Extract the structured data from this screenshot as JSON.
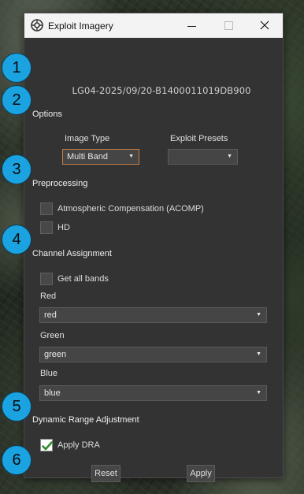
{
  "window": {
    "title": "Exploit Imagery",
    "app_icon": "gear-aperture-icon"
  },
  "image_id": "LG04-2025/09/20-B1400011019DB900",
  "sections": {
    "options": "Options",
    "preprocessing": "Preprocessing",
    "channel_assignment": "Channel Assignment",
    "dynamic_range": "Dynamic Range Adjustment"
  },
  "options": {
    "image_type_label": "Image Type",
    "image_type_value": "Multi Band",
    "exploit_presets_label": "Exploit Presets",
    "exploit_presets_value": ""
  },
  "preprocessing": {
    "acomp_label": "Atmospheric Compensation (ACOMP)",
    "acomp_checked": false,
    "hd_label": "HD",
    "hd_checked": false
  },
  "channels": {
    "get_all_bands_label": "Get all bands",
    "get_all_bands_checked": false,
    "red_label": "Red",
    "red_value": "red",
    "green_label": "Green",
    "green_value": "green",
    "blue_label": "Blue",
    "blue_value": "blue"
  },
  "dra": {
    "apply_dra_label": "Apply DRA",
    "apply_dra_checked": true
  },
  "buttons": {
    "reset": "Reset",
    "apply": "Apply"
  },
  "badges": [
    "1",
    "2",
    "3",
    "4",
    "5",
    "6"
  ],
  "colors": {
    "badge": "#1aa3e0",
    "panel": "#333333",
    "accent_border": "#c87f45",
    "check": "#2e8b2e"
  }
}
